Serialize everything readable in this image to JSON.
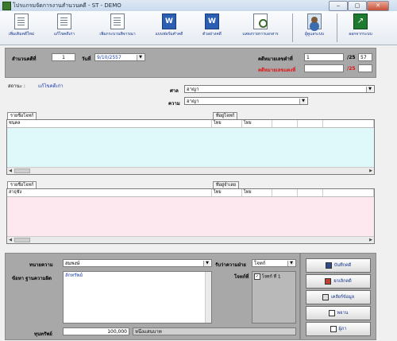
{
  "window": {
    "title": "โปรแกรมจัดการงานสำนวนคดี - ST - DEMO",
    "min": "‒",
    "max": "▢",
    "close": "✕"
  },
  "toolbar": {
    "items": [
      {
        "label": "เพิ่มเติมคดีใหม่",
        "icon": "new-case-icon"
      },
      {
        "label": "แก้ไขคดีเก่า",
        "icon": "edit-case-icon"
      },
      {
        "label": "เพิ่มกระบวนพิจารณา",
        "icon": "add-proceeding-icon"
      },
      {
        "label": "แบบฟอร์มคำคดี",
        "icon": "word-form-icon"
      },
      {
        "label": "ตัวอย่างคดี",
        "icon": "word-example-icon"
      },
      {
        "label": "แสดงรายการเอกสาร",
        "icon": "document-search-icon"
      },
      {
        "label": "ผู้ดูแลระบบ",
        "icon": "admin-users-icon"
      },
      {
        "label": "ออกจากระบบ",
        "icon": "exit-icon"
      }
    ]
  },
  "header": {
    "case_no_label": "สำนวนคดีที่",
    "case_no": "1",
    "date_label": "วันที่",
    "date_value": "9/10/2557",
    "black_case_label": "คดีหมายเลขดำที่",
    "black_case_no": "1",
    "black_case_sep": "/25",
    "black_case_year": "57",
    "red_case_label": "คดีหมายเลขแดงที่",
    "red_case_no": "",
    "red_case_sep": "/25",
    "red_case_year": ""
  },
  "status": {
    "label": "สถานะ :",
    "value": "แก้ไขคดีเก่า"
  },
  "court": {
    "label": "ศาล",
    "value": "อาญา"
  },
  "case_type": {
    "label": "ความ",
    "value": "อาญา"
  },
  "plaintiff": {
    "tab_names": "รายชื่อโจทก์",
    "tab_address": "ที่อยู่โจทก์",
    "columns": [
      "ชนคล",
      "ไทย",
      "ไทย",
      "",
      "",
      ""
    ],
    "rows": []
  },
  "defendant": {
    "tab_names": "รายชื่อโจทก์",
    "tab_address": "ที่อยู่จำเลย",
    "columns": [
      "สาธุชัง",
      "ไทย",
      "ไทย",
      "",
      "",
      ""
    ],
    "rows": []
  },
  "bottom": {
    "lawyer_label": "ทนายความ",
    "lawyer_value": "สมพงษ์",
    "accepted_by_label": "รับว่าความฝ่าย",
    "accepted_by_value": "โจทก์",
    "facts_label": "ข้อหา ฐานความผิด",
    "facts_value": "ลักทรัพย์",
    "plaintiff_no_label": "โจทก์ที่",
    "plaintiff_list": [
      {
        "label": "โจทก์ ที่ 1",
        "checked": true
      }
    ],
    "amount_label": "ทุนทรัพย์",
    "amount_value": "100,000",
    "amount_text": "หนึ่งแสนบาท"
  },
  "actions": {
    "save": "บันทึกคดี",
    "cancel": "ยกเลิกคดี",
    "clear": "เคลียร์ข้อมูล",
    "witness": "พยาน",
    "evidence": "ผู้ภา"
  }
}
